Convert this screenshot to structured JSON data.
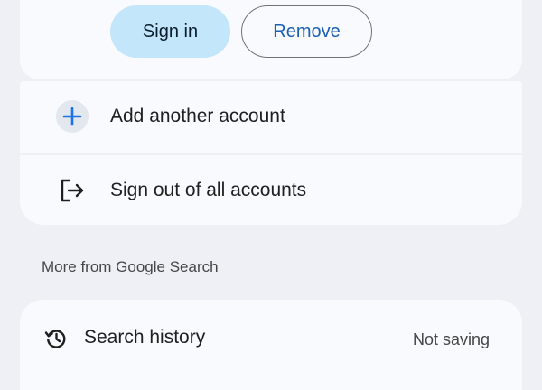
{
  "account_actions": {
    "sign_in_label": "Sign in",
    "remove_label": "Remove"
  },
  "account_menu": {
    "add_account_label": "Add another account",
    "add_account_icon": "plus-icon",
    "sign_out_all_label": "Sign out of all accounts",
    "sign_out_icon": "logout-icon"
  },
  "more_section": {
    "title": "More from Google Search",
    "search_history": {
      "label": "Search history",
      "status": "Not saving",
      "icon": "history-icon"
    }
  },
  "colors": {
    "background": "#eef0f6",
    "card": "#f9fafd",
    "primary_button_bg": "#c4e6fb",
    "link_blue": "#1a5fb4",
    "plus_blue": "#1a73e8"
  }
}
